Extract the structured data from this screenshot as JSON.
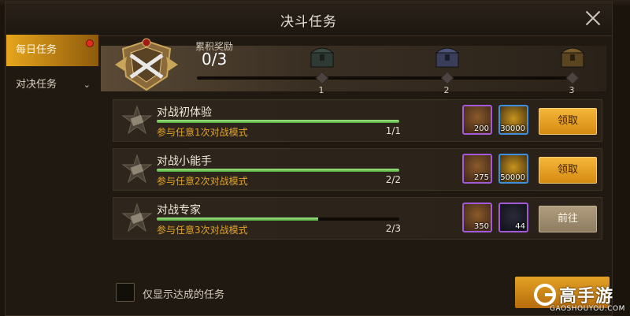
{
  "window": {
    "title": "决斗任务"
  },
  "sidebar": {
    "tabs": [
      {
        "label": "每日任务"
      },
      {
        "label": "对决任务"
      }
    ]
  },
  "accumulated": {
    "label": "累积奖励",
    "value": "0/3",
    "milestones": [
      "1",
      "2",
      "3"
    ]
  },
  "tasks": [
    {
      "title": "对战初体验",
      "desc": "参与任意1次对战模式",
      "progress_text": "1/1",
      "progress": 1.0,
      "rewards": [
        {
          "icon": "reward-badge-icon",
          "amount": "200"
        },
        {
          "icon": "gold-coins-icon",
          "amount": "30000"
        }
      ],
      "button": "领取",
      "button_state": "claim"
    },
    {
      "title": "对战小能手",
      "desc": "参与任意2次对战模式",
      "progress_text": "2/2",
      "progress": 1.0,
      "rewards": [
        {
          "icon": "reward-badge-icon",
          "amount": "275"
        },
        {
          "icon": "gold-coins-icon",
          "amount": "50000"
        }
      ],
      "button": "领取",
      "button_state": "claim"
    },
    {
      "title": "对战专家",
      "desc": "参与任意3次对战模式",
      "progress_text": "2/3",
      "progress": 0.667,
      "rewards": [
        {
          "icon": "reward-badge-icon",
          "amount": "350"
        },
        {
          "icon": "item-card-icon",
          "amount": "44"
        }
      ],
      "button": "前往",
      "button_state": "go"
    }
  ],
  "filter": {
    "label": "仅显示达成的任务"
  },
  "watermark": {
    "name": "高手游",
    "url": "GAOSHOUYOU.COM"
  },
  "colors": {
    "accent": "#e6a51c",
    "progress": "#6cc855",
    "desc": "#e2a428"
  }
}
